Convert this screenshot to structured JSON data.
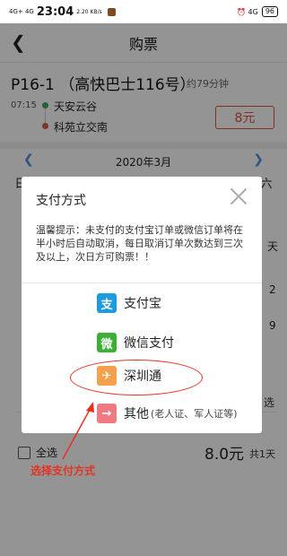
{
  "status_bar": {
    "network": "4G+ 4G",
    "time": "23:04",
    "speed": "2.20 KB/s",
    "right_indicators": "⏰ 4G",
    "battery": "96"
  },
  "header": {
    "back_icon": "chevron-left-icon",
    "title": "购票"
  },
  "route": {
    "name": "P16-1 （高快巴士116号）",
    "duration": "约79分钟",
    "start_time": "07:15",
    "stops": [
      "天安云谷",
      "科苑立交南"
    ],
    "price": "8元"
  },
  "calendar": {
    "month": "2020年3月",
    "weekdays": [
      "日",
      "一",
      "二",
      "三",
      "四",
      "五",
      "六"
    ],
    "visible_side_text": [
      "天",
      "2",
      "9",
      "选"
    ]
  },
  "bottom_bar": {
    "select_all_label": "全选",
    "total_price": "8.0元",
    "total_count": "共1天"
  },
  "annotation": {
    "text": "选择支付方式",
    "color": "#e53222"
  },
  "dialog": {
    "title": "支付方式",
    "tip": "温馨提示：未支付的支付宝订单或微信订单将在半小时后自动取消，每日取消订单次数达到三次及以上，次日方可购票！！",
    "options": [
      {
        "icon": "alipay-icon",
        "glyph": "支",
        "label": "支付宝"
      },
      {
        "icon": "wechat-pay-icon",
        "glyph": "微",
        "label": "微信支付"
      },
      {
        "icon": "shenzhentong-icon",
        "glyph": "✈",
        "label": "深圳通"
      },
      {
        "icon": "other-pay-icon",
        "glyph": "→",
        "label": "其他",
        "sub": "(老人证、军人证等)"
      }
    ]
  }
}
